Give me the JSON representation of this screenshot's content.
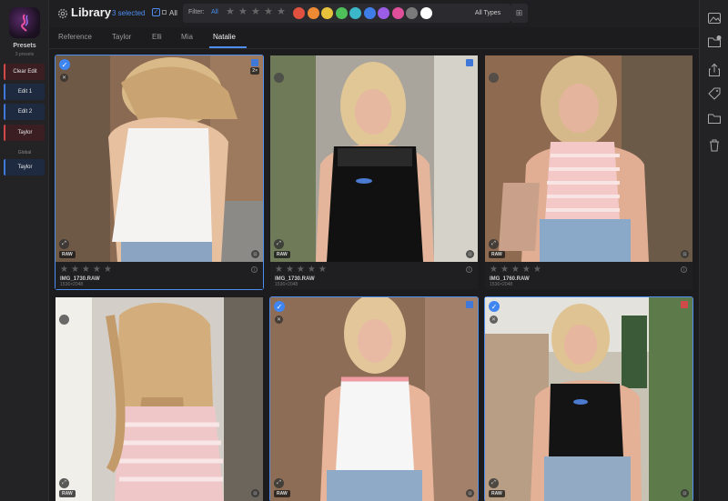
{
  "sidebar": {
    "title": "Presets",
    "subtitle": "3 presets",
    "presets": [
      {
        "label": "Clear Edit",
        "color": "#d04a4a"
      },
      {
        "label": "Edit 1",
        "color": "#3f78d8"
      },
      {
        "label": "Edit 2",
        "color": "#3f78d8"
      },
      {
        "label": "Taylor",
        "color": "#d04a4a"
      }
    ],
    "global_label": "Global",
    "global_presets": [
      {
        "label": "Taylor",
        "color": "#3f78d8"
      }
    ]
  },
  "header": {
    "title": "Library",
    "selected_count": "3 selected",
    "select_all_label": "All",
    "filter_label": "Filter:",
    "filter_value": "All",
    "types_label": "All Types",
    "accent": "#4d8ef0",
    "color_filters": [
      "#e0513f",
      "#ef8a34",
      "#e8c23a",
      "#4fbf59",
      "#3bb7c9",
      "#3f7ee8",
      "#9b5de5",
      "#e04f9a",
      "#7a7a7a",
      "#ffffff"
    ]
  },
  "tabs": [
    {
      "label": "Reference"
    },
    {
      "label": "Taylor"
    },
    {
      "label": "Elli"
    },
    {
      "label": "Mia"
    },
    {
      "label": "Natalie",
      "active": true
    }
  ],
  "photos": [
    {
      "selected": true,
      "file": "IMG_1730.RAW",
      "dims": "1536×2048",
      "badge": "RAW",
      "count": "2×",
      "flag_color": "#3f78d8"
    },
    {
      "selected": false,
      "file": "IMG_1730.RAW",
      "dims": "1536×2048",
      "badge": "RAW",
      "flag_color": "#3f78d8"
    },
    {
      "selected": false,
      "file": "IMG_1760.RAW",
      "dims": "1536×2048",
      "badge": "RAW"
    },
    {
      "selected": false,
      "badge": "RAW"
    },
    {
      "selected": true,
      "badge": "RAW",
      "flag_color": "#3f78d8"
    },
    {
      "selected": true,
      "badge": "RAW",
      "flag_color": "#d04a4a"
    }
  ],
  "icons": {
    "right_toolbar": [
      "image-icon",
      "new-folder-icon",
      "share-icon",
      "tag-icon",
      "folder-icon",
      "trash-icon"
    ]
  }
}
